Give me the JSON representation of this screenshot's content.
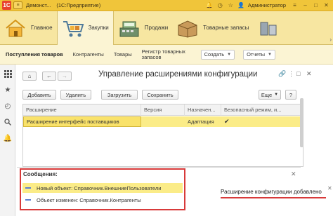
{
  "titlebar": {
    "app_title": "Демонст...",
    "app_title_full": "(1С:Предприятие)",
    "user": "Администратор"
  },
  "sections": [
    {
      "label": "Главное",
      "icon": "home-icon"
    },
    {
      "label": "Закупки",
      "icon": "shopping-cart-icon"
    },
    {
      "label": "Продажи",
      "icon": "cash-register-icon"
    },
    {
      "label": "Товарные запасы",
      "icon": "boxes-icon"
    }
  ],
  "funcbar": {
    "items": [
      "Поступления товаров",
      "Контрагенты",
      "Товары",
      "Регистр товарных запасов"
    ],
    "create_label": "Создать",
    "reports_label": "Отчеты"
  },
  "form": {
    "title": "Управление расширениями конфигурации",
    "buttons": {
      "add": "Добавить",
      "delete": "Удалить",
      "load": "Загрузить",
      "save": "Сохранить",
      "more": "Еще",
      "help": "?"
    },
    "table": {
      "columns": [
        "Расширение",
        "Версия",
        "Назначен...",
        "Безопасный режим, и..."
      ],
      "rows": [
        {
          "extension": "Расширение интерфейс поставщиков",
          "version": "",
          "purpose": "Адаптация",
          "safe_mode": true
        }
      ]
    }
  },
  "messages": {
    "title": "Сообщения:",
    "items": [
      "Новый объект: Справочник.ВнешниеПользователи",
      "Объект изменен: Справочник.Контрагенты"
    ]
  },
  "notification": {
    "text": "Расширение конфигурации добавлено"
  },
  "colors": {
    "accent_yellow": "#f0c53a",
    "selection": "#fbec88",
    "highlight_red": "#d83a3a"
  }
}
